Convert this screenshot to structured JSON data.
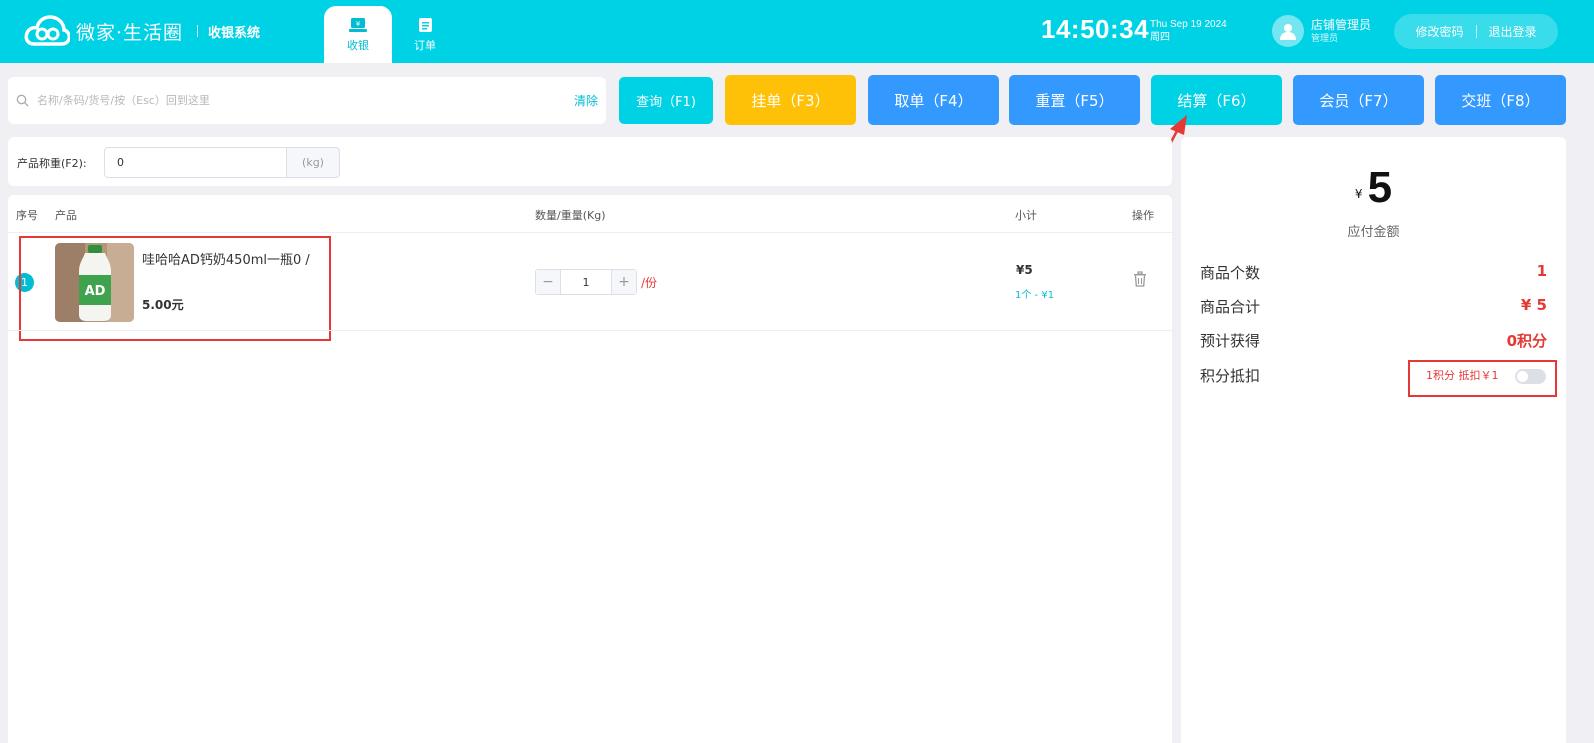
{
  "header": {
    "logo_text": "微家·生活圈",
    "system_name": "收银系统",
    "tabs": [
      {
        "label": "收银",
        "icon": "cashier-icon",
        "active": true
      },
      {
        "label": "订单",
        "icon": "clipboard-icon",
        "active": false
      }
    ],
    "time": "14:50:34",
    "date": "Thu Sep 19 2024",
    "weekday": "周四",
    "user_name": "店铺管理员",
    "user_role": "管理员",
    "change_password": "修改密码",
    "logout": "退出登录",
    "accent_color": "#00d2e6"
  },
  "search": {
    "placeholder": "名称/条码/货号/按（Esc）回到这里",
    "value": "",
    "clear_label": "清除"
  },
  "toolbar": {
    "query": "查询（F1)",
    "hold": "挂单（F3）",
    "fetch": "取单（F4）",
    "reset": "重置（F5）",
    "settle": "结算（F6）",
    "member": "会员（F7）",
    "shift": "交班（F8）"
  },
  "weight": {
    "label": "产品称重(F2):",
    "value": "0",
    "unit": "(kg)"
  },
  "table": {
    "headers": {
      "seq": "序号",
      "product": "产品",
      "qty": "数量/重量(Kg)",
      "subtotal": "小计",
      "action": "操作"
    },
    "rows": [
      {
        "index": "1",
        "name": "哇哈哈AD钙奶450ml一瓶0 /",
        "price": "5.00元",
        "qty": "1",
        "per_unit": "/份",
        "subtotal": "¥5",
        "detail": "1个 - ¥1"
      }
    ]
  },
  "summary": {
    "currency": "¥",
    "amount": "5",
    "amount_label": "应付金额",
    "item_count_label": "商品个数",
    "item_count": "1",
    "total_label": "商品合计",
    "total": "¥ 5",
    "points_label": "预计获得",
    "points": "0积分",
    "redeem_label": "积分抵扣",
    "redeem_info": "1积分 抵扣￥1",
    "redeem_enabled": false
  }
}
